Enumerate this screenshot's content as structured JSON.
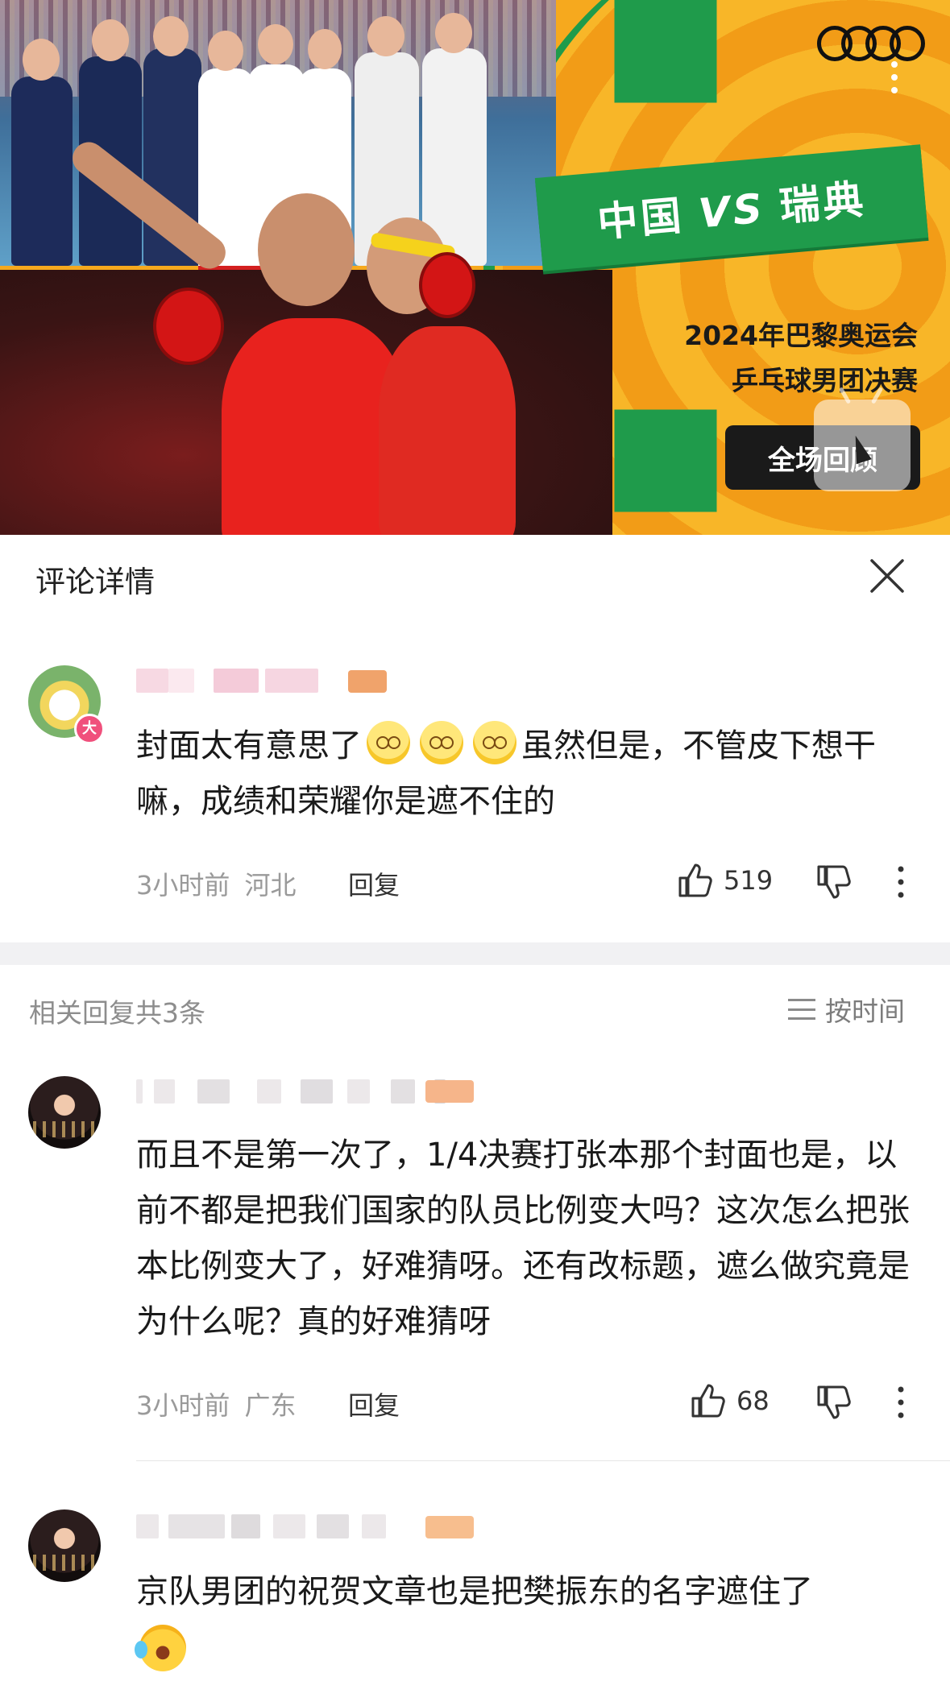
{
  "cover": {
    "match_title_left": "中国",
    "match_title_vs": "VS",
    "match_title_right": "瑞典",
    "event_line1": "2024年巴黎奥运会",
    "event_line2": "乒乓球男团决赛",
    "replay_button": "全场回顾",
    "accent_colors": {
      "orange": "#f6a91e",
      "green": "#1f9b4b",
      "dark": "#1a1a1a"
    }
  },
  "panel": {
    "title": "评论详情"
  },
  "main_comment": {
    "text_part1": "封面太有意思了",
    "text_part2": "虽然但是，不管皮下想干嘛，成绩和荣耀你是遮不住的",
    "avatar_badge": "大",
    "time": "3小时前",
    "location": "河北",
    "reply_label": "回复",
    "likes": "519"
  },
  "related": {
    "title": "相关回复共3条",
    "sort_label": "按时间"
  },
  "replies": [
    {
      "text": "而且不是第一次了，1/4决赛打张本那个封面也是，以前不都是把我们国家的队员比例变大吗？这次怎么把张本比例变大了，好难猜呀。还有改标题，遮么做究竟是为什么呢？真的好难猜呀",
      "time": "3小时前",
      "location": "广东",
      "reply_label": "回复",
      "likes": "68"
    },
    {
      "text": "京队男团的祝贺文章也是把樊振东的名字遮住了"
    }
  ]
}
